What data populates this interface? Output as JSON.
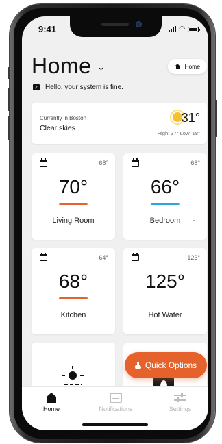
{
  "status_bar": {
    "time": "9:41"
  },
  "header": {
    "title": "Home",
    "home_chip_label": "Home",
    "status_message": "Hello, your system is fine."
  },
  "weather": {
    "location": "Currently in Boston",
    "condition": "Clear skies",
    "temperature": "31°",
    "high_low": "High: 37° Low: 18°"
  },
  "zones": [
    {
      "name": "Living Room",
      "temp": "70°",
      "setpoint": "68°",
      "accent": "#e5622c"
    },
    {
      "name": "Bedroom",
      "temp": "66°",
      "setpoint": "68°",
      "accent": "#2aa7de"
    },
    {
      "name": "Kitchen",
      "temp": "68°",
      "setpoint": "64°",
      "accent": "#e5622c"
    },
    {
      "name": "Hot Water",
      "temp": "125°",
      "setpoint": "123°",
      "accent": ""
    }
  ],
  "quick_options": {
    "label": "Quick Options",
    "color": "#e5622c"
  },
  "tabbar": {
    "home": "Home",
    "notifications": "Notifications",
    "settings": "Settings"
  }
}
